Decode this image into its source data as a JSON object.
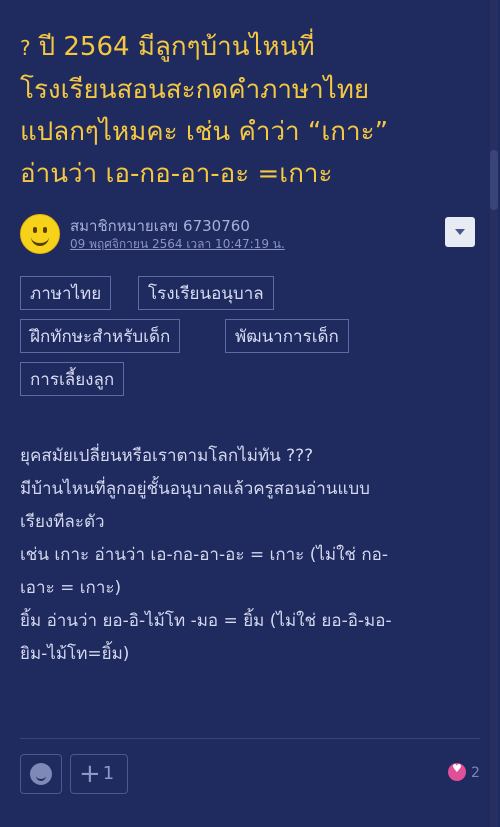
{
  "post": {
    "icon": "?",
    "title_lines": [
      "ปี 2564 มีลูกๆบ้านไหนที่",
      "โรงเรียนสอนสะกดคำภาษาไทย",
      "แปลกๆไหมคะ เช่น คำว่า “เกาะ”",
      "อ่านว่า เอ-กอ-อา-อะ =เกาะ"
    ],
    "author": {
      "member_label": "สมาชิกหมายเลข 6730760",
      "date": "09 พฤศจิกายน 2564 เวลา 10:47:19 น."
    },
    "tags": [
      "ภาษาไทย",
      "โรงเรียนอนุบาล",
      "ฝึกทักษะสำหรับเด็ก",
      "พัฒนาการเด็ก",
      "การเลี้ยงลูก"
    ],
    "body_lines": [
      "ยุคสมัยเปลี่ยนหรือเราตามโลกไม่ทัน ???",
      "มีบ้านไหนที่ลูกอยู่ชั้นอนุบาลแล้วครูสอนอ่านแบบ",
      "เรียงทีละตัว",
      "เช่น เกาะ อ่านว่า เอ-กอ-อา-อะ = เกาะ (ไม่ใช่ กอ-",
      "เอาะ = เกาะ)",
      "ยิ้ม อ่านว่า ยอ-อิ-ไม้โท -มอ = ยิ้ม (ไม่ใช่ ยอ-อิ-มอ-",
      "ยิม-ไม้โท=ยิ้ม)"
    ],
    "actions": {
      "plus_count": "1",
      "heart_count": "2"
    }
  },
  "colors": {
    "background": "#1f2a5e",
    "title": "#f5c842",
    "heart": "#e04f98"
  }
}
